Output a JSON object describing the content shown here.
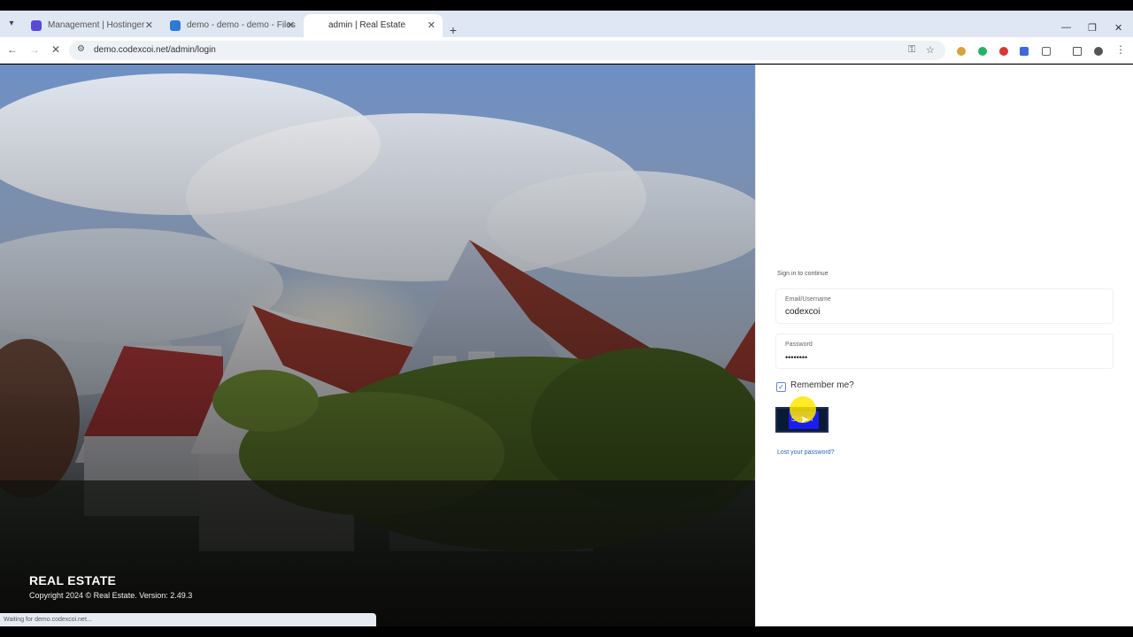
{
  "browser": {
    "tabs": [
      {
        "title": "Management | Hostinger",
        "favicon_color": "#5b48d6",
        "active": false
      },
      {
        "title": "demo - demo - demo - Files",
        "favicon_color": "#2b7bd6",
        "active": false
      },
      {
        "title": "admin | Real Estate",
        "favicon_color": "#ffffff",
        "active": true
      }
    ],
    "url": "demo.codexcoi.net/admin/login"
  },
  "hero": {
    "brand_title": "REAL ESTATE",
    "copyright": "Copyright 2024 © Real Estate. Version: 2.49.3",
    "status_text": "Waiting for demo.codexcoi.net..."
  },
  "login": {
    "heading": "Sign in to continue",
    "email_label": "Email/Username",
    "email_value": "codexcoi",
    "password_label": "Password",
    "password_value": "••••••••",
    "remember_label": "Remember me?",
    "remember_checked": true,
    "signin_label": "Sign in",
    "lost_password_label": "Lost your password?"
  },
  "colors": {
    "signin_button": "#0b1a33",
    "link": "#2d5fb8",
    "cursor_highlight": "#ffe800"
  }
}
